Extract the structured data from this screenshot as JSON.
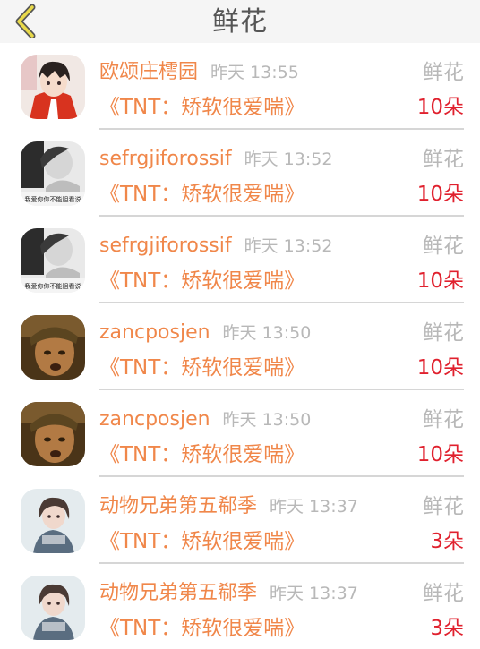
{
  "header": {
    "title": "鲜花",
    "back_icon": "chevron-left-icon",
    "accent_color": "#e8d94a"
  },
  "colors": {
    "name": "#f0874a",
    "time": "#b8b8b8",
    "count": "#e0212e"
  },
  "records": [
    {
      "name": "欧颂庄樗园",
      "time": "昨天 13:55",
      "gift": "鲜花",
      "song": "《TNT：矫软很爱喘》",
      "count": "10朵",
      "avatar": "anime-avatar"
    },
    {
      "name": "sefrgjiforossif",
      "time": "昨天 13:52",
      "gift": "鲜花",
      "song": "《TNT：矫软很爱喘》",
      "count": "10朵",
      "avatar": "bw-photo-avatar",
      "avatar_caption": "我爱你你不能阻看说"
    },
    {
      "name": "sefrgjiforossif",
      "time": "昨天 13:52",
      "gift": "鲜花",
      "song": "《TNT：矫软很爱喘》",
      "count": "10朵",
      "avatar": "bw-photo-avatar",
      "avatar_caption": "我爱你你不能阻看说"
    },
    {
      "name": "zancposjen",
      "time": "昨天 13:50",
      "gift": "鲜花",
      "song": "《TNT：矫软很爱喘》",
      "count": "10朵",
      "avatar": "soldier-avatar"
    },
    {
      "name": "zancposjen",
      "time": "昨天 13:50",
      "gift": "鲜花",
      "song": "《TNT：矫软很爱喘》",
      "count": "10朵",
      "avatar": "soldier-avatar"
    },
    {
      "name": "动物兄弟第五郗季",
      "time": "昨天 13:37",
      "gift": "鲜花",
      "song": "《TNT：矫软很爱喘》",
      "count": "3朵",
      "avatar": "girl-avatar"
    },
    {
      "name": "动物兄弟第五郗季",
      "time": "昨天 13:37",
      "gift": "鲜花",
      "song": "《TNT：矫软很爱喘》",
      "count": "3朵",
      "avatar": "girl-avatar"
    }
  ]
}
